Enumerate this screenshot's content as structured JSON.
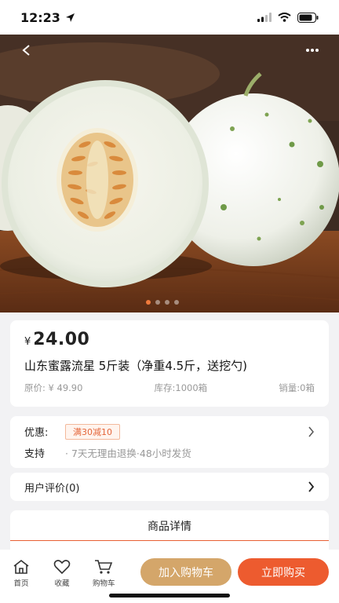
{
  "status_bar": {
    "time": "12:23"
  },
  "hero": {
    "slide_count": 4,
    "active_slide": 0
  },
  "product": {
    "currency": "¥",
    "price": "24.00",
    "title": "山东蜜露流星 5斤装（净重4.5斤，送挖勺)",
    "original_price": "原价: ¥ 49.90",
    "stock": "库存:1000箱",
    "sales": "销量:0箱"
  },
  "promo": {
    "label": "优惠:",
    "tag": "满30减10",
    "support_label": "支持",
    "support_text": "· 7天无理由退换·48小时发货"
  },
  "reviews": {
    "label": "用户评价(0)"
  },
  "details": {
    "label": "商品详情"
  },
  "bottom_nav": {
    "home": "首页",
    "favorite": "收藏",
    "cart": "购物车",
    "add_to_cart": "加入购物车",
    "buy_now": "立即购买"
  },
  "colors": {
    "accent": "#ed5b2f",
    "cart_button": "#d4a66a",
    "active_dot": "#f07a3c"
  }
}
